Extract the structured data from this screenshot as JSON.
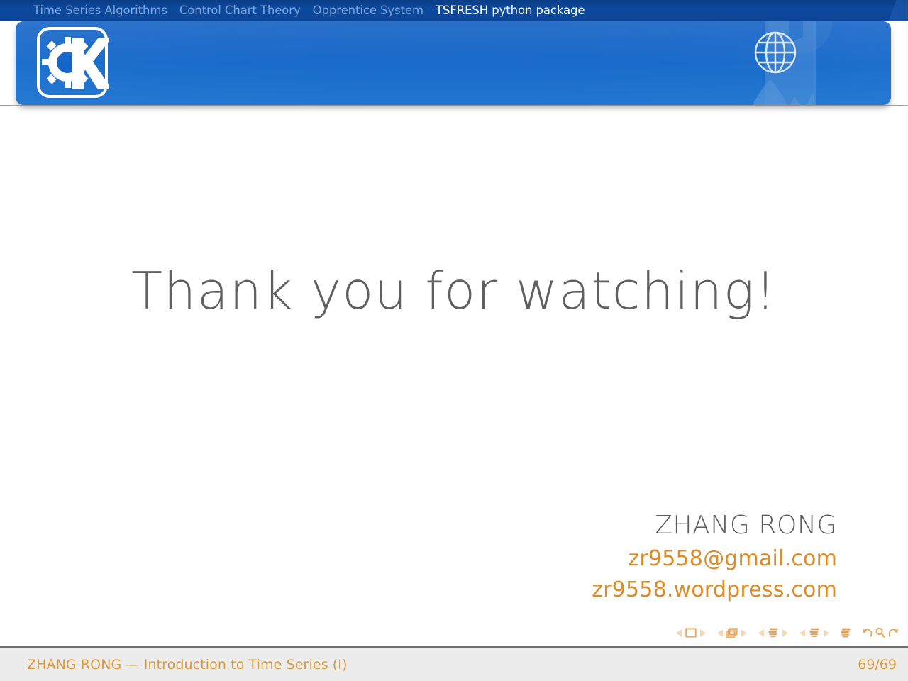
{
  "colors": {
    "nav_strip": "#0c4495",
    "header_blue": "#1565c8",
    "accent_orange": "#dd8b27",
    "footer_orange": "#d9983a",
    "title_gray": "#606060",
    "footer_bg": "#edecec",
    "nav_inactive": "#7ea6dd",
    "nav_active": "#ffffff"
  },
  "navbar": {
    "items": [
      {
        "label": "Time Series Algorithms",
        "active": false
      },
      {
        "label": "Control Chart Theory",
        "active": false
      },
      {
        "label": "Opprentice System",
        "active": false
      },
      {
        "label": "TSFRESH python package",
        "active": true
      }
    ]
  },
  "header": {
    "logo_icon": "kde-gear-k-logo",
    "globe_icon": "globe-icon",
    "motif_icon": "gear-mountain-motif"
  },
  "main": {
    "title": "Thank you for watching!",
    "signature": {
      "name": "ZHANG RONG",
      "email": "zr9558@gmail.com",
      "website": "zr9558.wordpress.com"
    }
  },
  "nav_symbols": {
    "groups": [
      {
        "name": "slide",
        "icon": "slide-icon"
      },
      {
        "name": "frame",
        "icon": "frame-icon"
      },
      {
        "name": "subsection",
        "icon": "subsection-icon"
      },
      {
        "name": "section",
        "icon": "section-icon"
      }
    ],
    "presentation": {
      "name": "presentation",
      "icon": "presentation-icon"
    },
    "extras": [
      {
        "name": "back",
        "icon": "back-arrow-icon"
      },
      {
        "name": "search",
        "icon": "search-icon"
      },
      {
        "name": "forward",
        "icon": "forward-arrow-icon"
      }
    ]
  },
  "footer": {
    "left": "ZHANG RONG — Introduction to Time Series (I)",
    "page": "69/69"
  }
}
